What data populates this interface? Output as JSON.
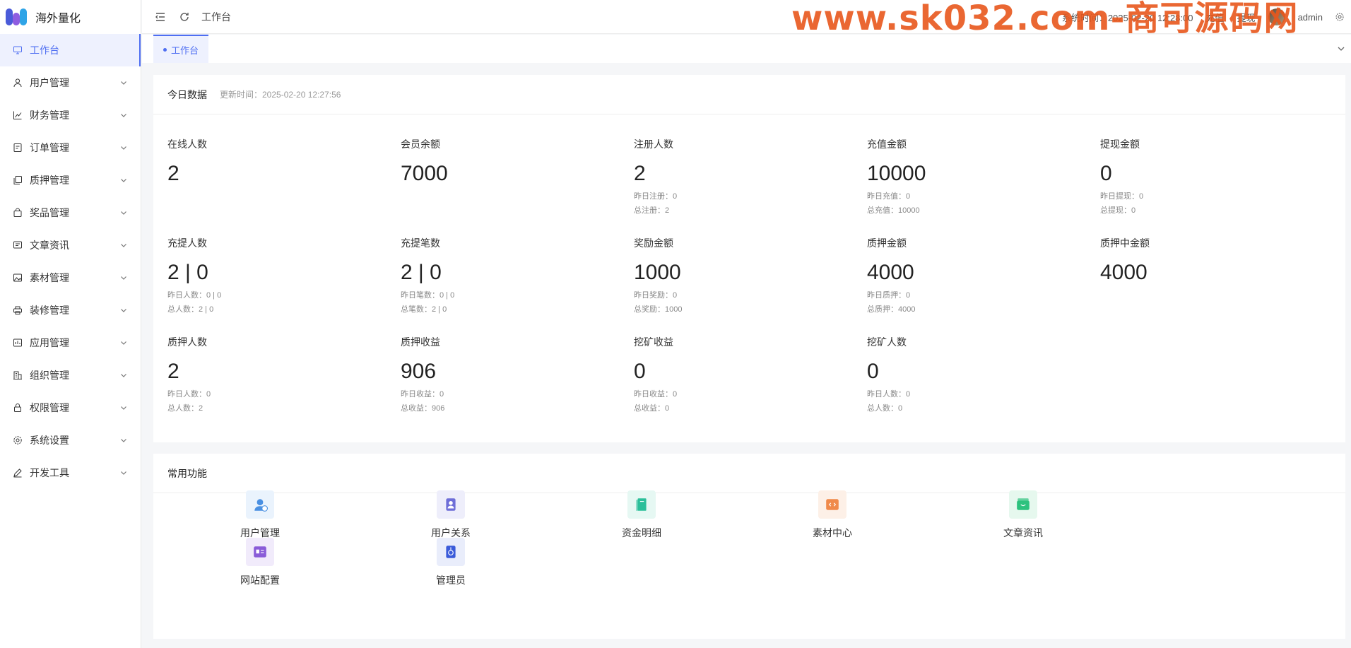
{
  "app": {
    "title": "海外量化"
  },
  "sidebar": {
    "items": [
      {
        "label": "工作台",
        "icon": "monitor-icon",
        "active": true
      },
      {
        "label": "用户管理",
        "icon": "user-icon"
      },
      {
        "label": "财务管理",
        "icon": "chart-icon"
      },
      {
        "label": "订单管理",
        "icon": "order-icon"
      },
      {
        "label": "质押管理",
        "icon": "copy-icon"
      },
      {
        "label": "奖品管理",
        "icon": "bag-icon"
      },
      {
        "label": "文章资讯",
        "icon": "message-icon"
      },
      {
        "label": "素材管理",
        "icon": "image-icon"
      },
      {
        "label": "装修管理",
        "icon": "printer-icon"
      },
      {
        "label": "应用管理",
        "icon": "app-icon"
      },
      {
        "label": "组织管理",
        "icon": "building-icon"
      },
      {
        "label": "权限管理",
        "icon": "lock-icon"
      },
      {
        "label": "系统设置",
        "icon": "gear-icon"
      },
      {
        "label": "开发工具",
        "icon": "pen-icon"
      }
    ]
  },
  "header": {
    "breadcrumb": "工作台",
    "right": {
      "time": "系统时间：2025-02-20 12:28:00",
      "recharge": "充值",
      "withdraw": "提现",
      "user": "admin"
    },
    "watermark": "www.sk032.com-商可源码网"
  },
  "tabs": [
    {
      "label": "工作台"
    }
  ],
  "stats": {
    "title": "今日数据",
    "updated": "更新时间：2025-02-20 12:27:56",
    "items": [
      {
        "label": "在线人数",
        "value": "2",
        "subs": []
      },
      {
        "label": "会员余额",
        "value": "7000",
        "subs": []
      },
      {
        "label": "注册人数",
        "value": "2",
        "subs": [
          "昨日注册：0",
          "总注册：2"
        ]
      },
      {
        "label": "充值金额",
        "value": "10000",
        "subs": [
          "昨日充值：0",
          "总充值：10000"
        ]
      },
      {
        "label": "提现金额",
        "value": "0",
        "subs": [
          "昨日提现：0",
          "总提现：0"
        ]
      },
      {
        "label": "充提人数",
        "value": "2 | 0",
        "subs": [
          "昨日人数：0 | 0",
          "总人数：2 | 0"
        ]
      },
      {
        "label": "充提笔数",
        "value": "2 | 0",
        "subs": [
          "昨日笔数：0 | 0",
          "总笔数：2 | 0"
        ]
      },
      {
        "label": "奖励金额",
        "value": "1000",
        "subs": [
          "昨日奖励：0",
          "总奖励：1000"
        ]
      },
      {
        "label": "质押金额",
        "value": "4000",
        "subs": [
          "昨日质押：0",
          "总质押：4000"
        ]
      },
      {
        "label": "质押中金额",
        "value": "4000",
        "subs": []
      },
      {
        "label": "质押人数",
        "value": "2",
        "subs": [
          "昨日人数：0",
          "总人数：2"
        ]
      },
      {
        "label": "质押收益",
        "value": "906",
        "subs": [
          "昨日收益：0",
          "总收益：906"
        ]
      },
      {
        "label": "挖矿收益",
        "value": "0",
        "subs": [
          "昨日收益：0",
          "总收益：0"
        ]
      },
      {
        "label": "挖矿人数",
        "value": "0",
        "subs": [
          "昨日人数：0",
          "总人数：0"
        ]
      }
    ]
  },
  "functions": {
    "title": "常用功能",
    "items": [
      {
        "label": "用户管理",
        "icon": "user-manage-icon",
        "color": "#4a90e2",
        "bg": "#eaf3fd"
      },
      {
        "label": "用户关系",
        "icon": "user-relation-icon",
        "color": "#6e6ed8",
        "bg": "#eeeefb"
      },
      {
        "label": "资金明细",
        "icon": "fund-detail-icon",
        "color": "#2bbf9a",
        "bg": "#e6f8f3"
      },
      {
        "label": "素材中心",
        "icon": "material-center-icon",
        "color": "#f08a4b",
        "bg": "#fdf0e7"
      },
      {
        "label": "文章资讯",
        "icon": "article-icon",
        "color": "#2ec27e",
        "bg": "#e6f8ee"
      },
      {
        "label": "网站配置",
        "icon": "site-config-icon",
        "color": "#8a5cd8",
        "bg": "#f1ebfb"
      },
      {
        "label": "管理员",
        "icon": "admin-icon",
        "color": "#3a5bd9",
        "bg": "#e9edfb"
      }
    ]
  }
}
